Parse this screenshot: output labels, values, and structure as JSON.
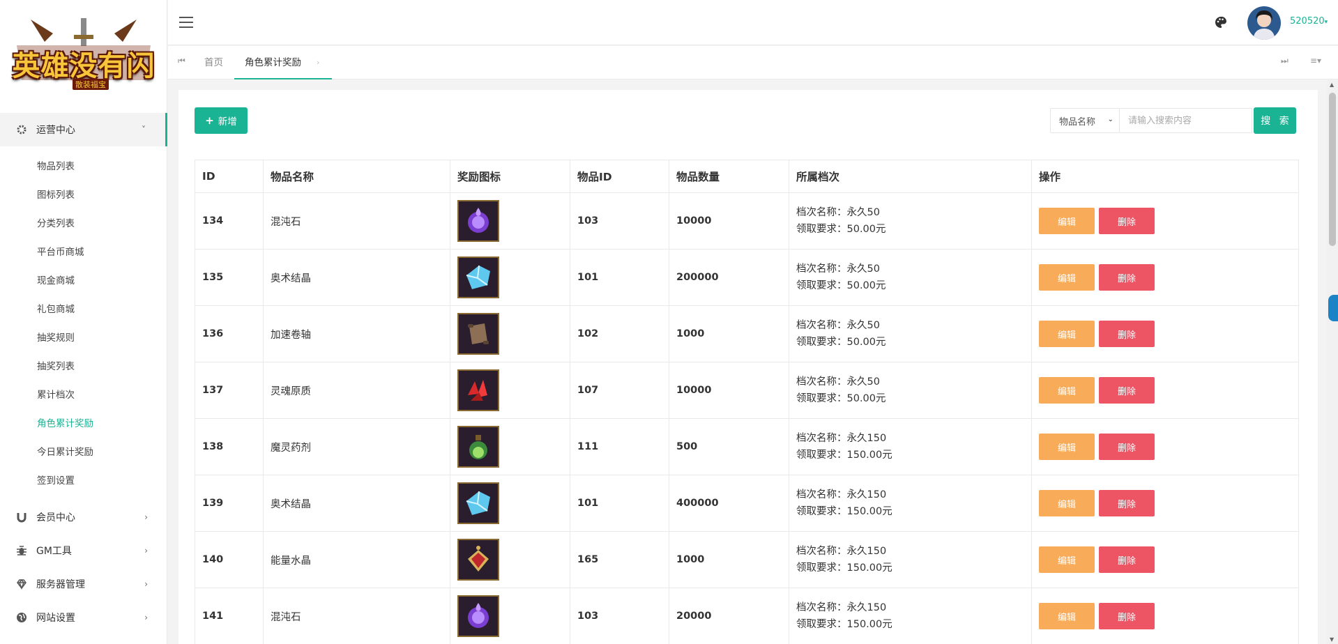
{
  "logo": {
    "text": "英雄没有闪",
    "subtitle": "散装福宝"
  },
  "sidebar": {
    "groups": [
      {
        "label": "运营中心",
        "icon": "gear-icon",
        "expanded": true
      },
      {
        "label": "会员中心",
        "icon": "magnet-icon",
        "expanded": false
      },
      {
        "label": "GM工具",
        "icon": "bug-icon",
        "expanded": false
      },
      {
        "label": "服务器管理",
        "icon": "diamond-icon",
        "expanded": false
      },
      {
        "label": "网站设置",
        "icon": "globe-icon",
        "expanded": false
      }
    ],
    "sub_items": [
      {
        "label": "物品列表"
      },
      {
        "label": "图标列表"
      },
      {
        "label": "分类列表"
      },
      {
        "label": "平台币商城"
      },
      {
        "label": "现金商城"
      },
      {
        "label": "礼包商城"
      },
      {
        "label": "抽奖规则"
      },
      {
        "label": "抽奖列表"
      },
      {
        "label": "累计档次"
      },
      {
        "label": "角色累计奖励",
        "active": true
      },
      {
        "label": "今日累计奖励"
      },
      {
        "label": "签到设置"
      }
    ]
  },
  "header": {
    "username": "520520",
    "accent_color": "#1ab394"
  },
  "tabs": {
    "home": "首页",
    "current": "角色累计奖励"
  },
  "toolbar": {
    "add_label": "新增",
    "search_field": "物品名称",
    "search_placeholder": "请输入搜索内容",
    "search_label": "搜 索"
  },
  "table": {
    "columns": [
      "ID",
      "物品名称",
      "奖励图标",
      "物品ID",
      "物品数量",
      "所属档次",
      "操作"
    ],
    "tier_name_prefix": "档次名称：",
    "tier_req_prefix": "领取要求：",
    "edit_label": "编辑",
    "delete_label": "删除",
    "rows": [
      {
        "id": "134",
        "name": "混沌石",
        "icon": "purple-orb-icon",
        "item_id": "103",
        "qty": "10000",
        "tier_name": "永久50",
        "tier_req": "50.00元"
      },
      {
        "id": "135",
        "name": "奥术结晶",
        "icon": "blue-crystal-icon",
        "item_id": "101",
        "qty": "200000",
        "tier_name": "永久50",
        "tier_req": "50.00元"
      },
      {
        "id": "136",
        "name": "加速卷轴",
        "icon": "scroll-icon",
        "item_id": "102",
        "qty": "1000",
        "tier_name": "永久50",
        "tier_req": "50.00元"
      },
      {
        "id": "137",
        "name": "灵魂原质",
        "icon": "red-crystal-icon",
        "item_id": "107",
        "qty": "10000",
        "tier_name": "永久50",
        "tier_req": "50.00元"
      },
      {
        "id": "138",
        "name": "魔灵药剂",
        "icon": "potion-icon",
        "item_id": "111",
        "qty": "500",
        "tier_name": "永久150",
        "tier_req": "150.00元"
      },
      {
        "id": "139",
        "name": "奥术结晶",
        "icon": "blue-crystal-icon",
        "item_id": "101",
        "qty": "400000",
        "tier_name": "永久150",
        "tier_req": "150.00元"
      },
      {
        "id": "140",
        "name": "能量水晶",
        "icon": "red-amulet-icon",
        "item_id": "165",
        "qty": "1000",
        "tier_name": "永久150",
        "tier_req": "150.00元"
      },
      {
        "id": "141",
        "name": "混沌石",
        "icon": "purple-orb-icon",
        "item_id": "103",
        "qty": "20000",
        "tier_name": "永久150",
        "tier_req": "150.00元"
      }
    ]
  }
}
